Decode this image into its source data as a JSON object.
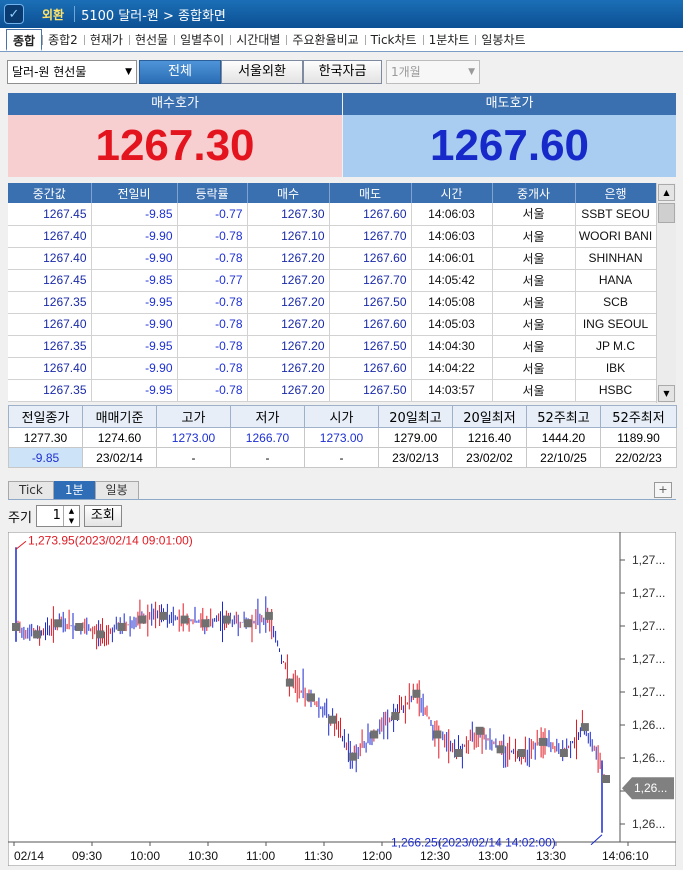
{
  "titlebar": {
    "badge": "외환",
    "title": "5100 달러-원 > 종합화면"
  },
  "tabs": [
    "종합",
    "종합2",
    "현재가",
    "현선물",
    "일별추이",
    "시간대별",
    "주요환율비교",
    "Tick차트",
    "1분차트",
    "일봉차트"
  ],
  "filters": {
    "market_select": "달러-원 현선물",
    "seg_all": "전체",
    "seg_seoul": "서울외환",
    "seg_korea": "한국자금",
    "period_select": "1개월"
  },
  "quote": {
    "bid_label": "매수호가",
    "bid_value": "1267.30",
    "ask_label": "매도호가",
    "ask_value": "1267.60"
  },
  "tick_table": {
    "headers": [
      "중간값",
      "전일비",
      "등락률",
      "매수",
      "매도",
      "시간",
      "중개사",
      "은행"
    ],
    "rows": [
      [
        "1267.45",
        "-9.85",
        "-0.77",
        "1267.30",
        "1267.60",
        "14:06:03",
        "서울",
        "SSBT SEOU"
      ],
      [
        "1267.40",
        "-9.90",
        "-0.78",
        "1267.10",
        "1267.70",
        "14:06:03",
        "서울",
        "WOORI BANI"
      ],
      [
        "1267.40",
        "-9.90",
        "-0.78",
        "1267.20",
        "1267.60",
        "14:06:01",
        "서울",
        "SHINHAN"
      ],
      [
        "1267.45",
        "-9.85",
        "-0.77",
        "1267.20",
        "1267.70",
        "14:05:42",
        "서울",
        "HANA"
      ],
      [
        "1267.35",
        "-9.95",
        "-0.78",
        "1267.20",
        "1267.50",
        "14:05:08",
        "서울",
        "SCB"
      ],
      [
        "1267.40",
        "-9.90",
        "-0.78",
        "1267.20",
        "1267.60",
        "14:05:03",
        "서울",
        "ING SEOUL"
      ],
      [
        "1267.35",
        "-9.95",
        "-0.78",
        "1267.20",
        "1267.50",
        "14:04:30",
        "서울",
        "JP M.C"
      ],
      [
        "1267.40",
        "-9.90",
        "-0.78",
        "1267.20",
        "1267.60",
        "14:04:22",
        "서울",
        "IBK"
      ],
      [
        "1267.35",
        "-9.95",
        "-0.78",
        "1267.20",
        "1267.50",
        "14:03:57",
        "서울",
        "HSBC"
      ]
    ]
  },
  "stats": {
    "headers": [
      "전일종가",
      "매매기준",
      "고가",
      "저가",
      "시가",
      "20일최고",
      "20일최저",
      "52주최고",
      "52주최저"
    ],
    "row1": [
      "1277.30",
      "1274.60",
      "1273.00",
      "1266.70",
      "1273.00",
      "1279.00",
      "1216.40",
      "1444.20",
      "1189.90"
    ],
    "row2": [
      "-9.85",
      "23/02/14",
      "-",
      "-",
      "-",
      "23/02/13",
      "23/02/02",
      "22/10/25",
      "22/02/23"
    ]
  },
  "chart_tabs": [
    "Tick",
    "1분",
    "일봉"
  ],
  "chart_plus": "+",
  "period": {
    "label": "주기",
    "value": "1",
    "query_button": "조회"
  },
  "chart_data": {
    "type": "candlestick",
    "high_annotation": "1,273.95(2023/02/14 09:01:00)",
    "low_annotation": "1,266.25(2023/02/14 14:02:00)",
    "current_price_label": "1,26...",
    "x_ticks": [
      "02/14",
      "09:30",
      "10:00",
      "10:30",
      "11:00",
      "11:30",
      "12:00",
      "12:30",
      "13:00",
      "13:30",
      "14:06:10"
    ],
    "y_ticks": [
      "1,27...",
      "1,27...",
      "1,27...",
      "1,27...",
      "1,27...",
      "1,26...",
      "1,26...",
      "1,26...",
      "1,26..."
    ],
    "ylim": [
      1266.0,
      1274.2
    ],
    "high": 1273.95,
    "low": 1266.25,
    "close_markers": [
      1271.8,
      1271.6,
      1271.9,
      1271.8,
      1271.6,
      1271.8,
      1272.0,
      1272.1,
      1272.0,
      1271.9,
      1272.0,
      1271.9,
      1272.1,
      1270.3,
      1269.9,
      1269.3,
      1268.3,
      1268.9,
      1269.4,
      1270.0,
      1268.9,
      1268.4,
      1269.0,
      1268.5,
      1268.4,
      1268.7,
      1268.4,
      1269.1,
      1267.7
    ],
    "colors": {
      "up": "#e01b24",
      "down": "#1a2ad0",
      "marker": "#707070"
    }
  }
}
